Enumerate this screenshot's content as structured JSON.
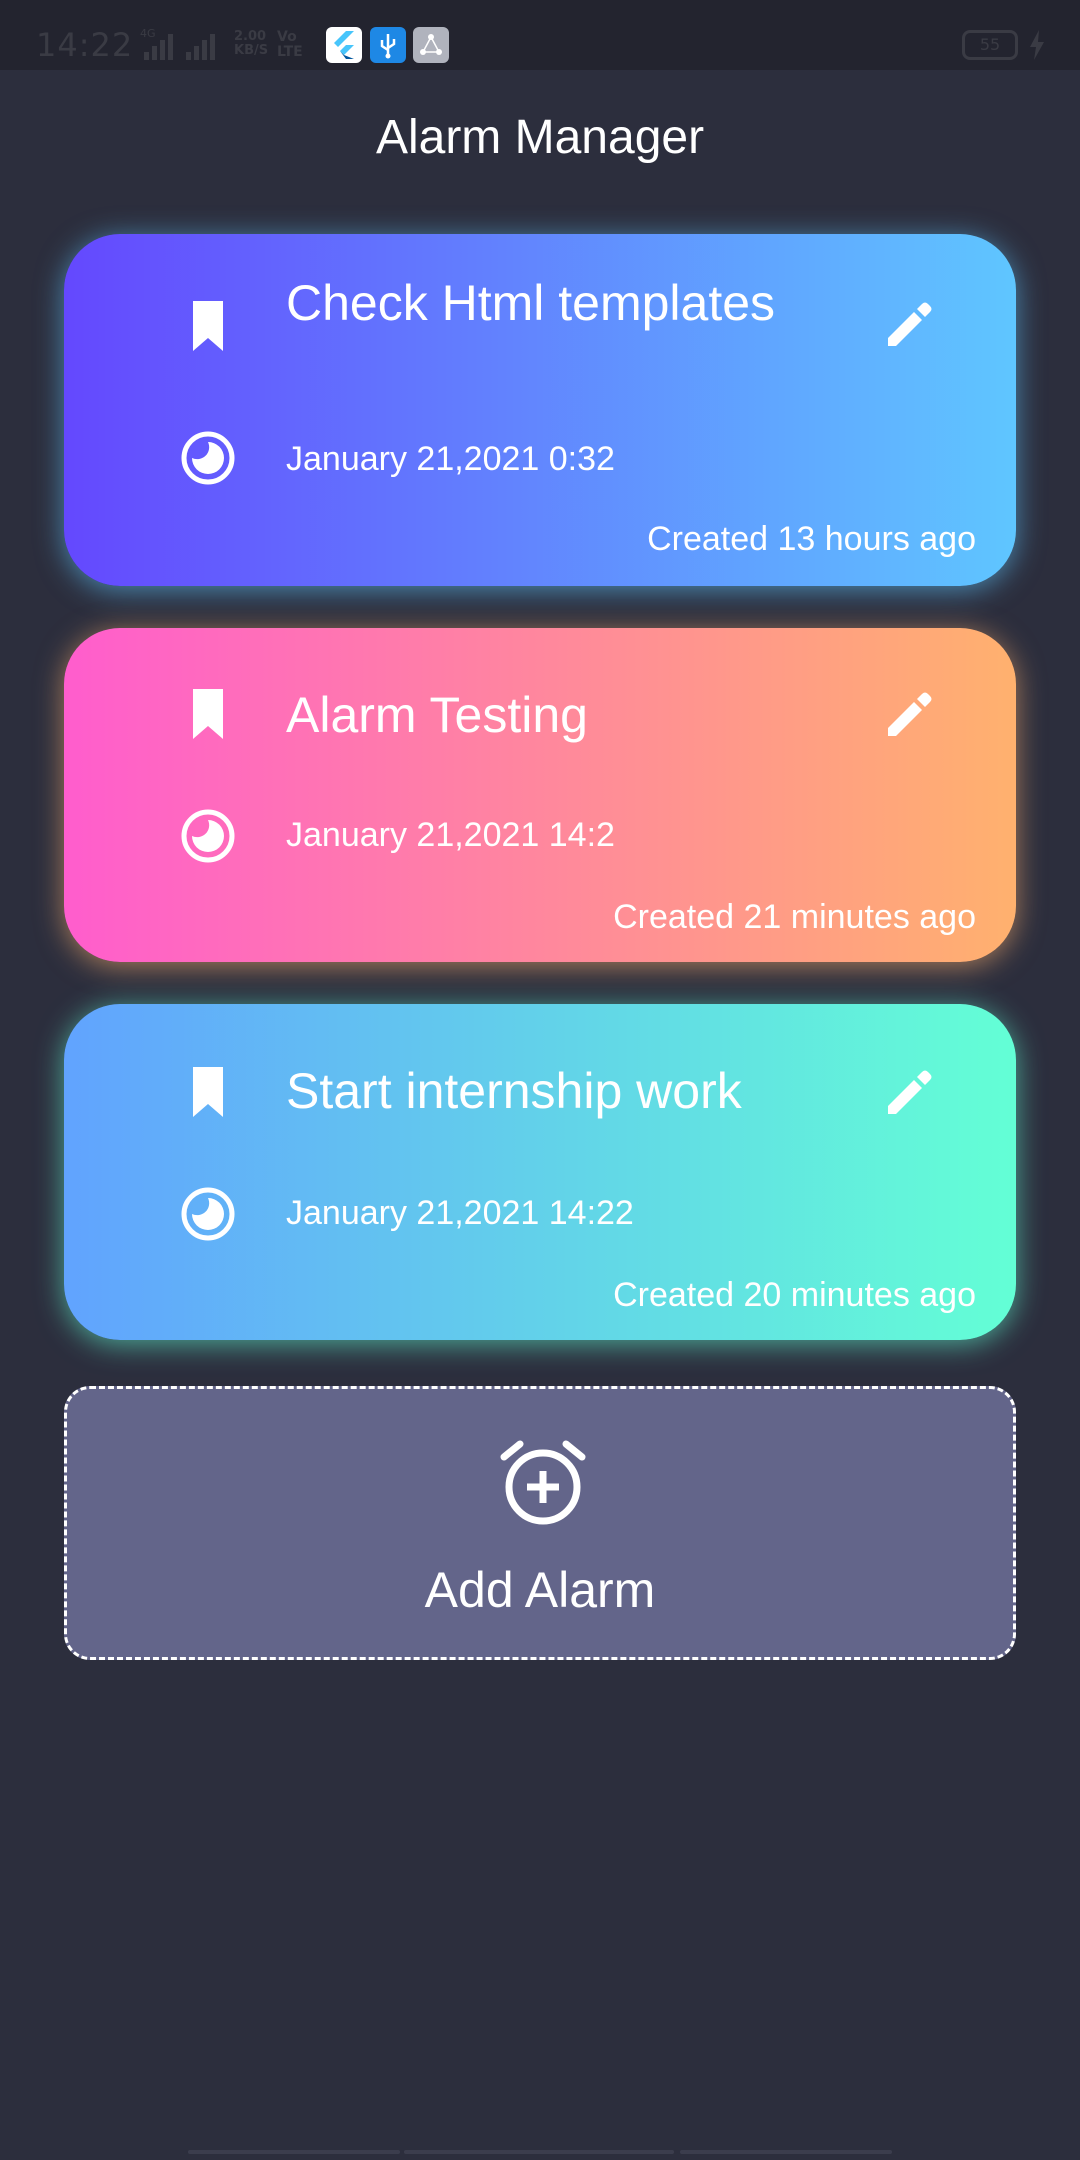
{
  "status_bar": {
    "time": "14:22",
    "network": "4G",
    "speed_value": "2.00",
    "speed_unit": "KB/S",
    "volte_line1": "Vo",
    "volte_line2": "LTE",
    "battery": "55"
  },
  "header": {
    "title": "Alarm Manager"
  },
  "alarms": [
    {
      "title": "Check Html templates",
      "datetime": "January 21,2021 0:32",
      "created": "Created 13 hours ago",
      "gradient": [
        "#6448fe",
        "#5fc6ff"
      ],
      "glow": "#5fc6ff"
    },
    {
      "title": "Alarm Testing",
      "datetime": "January 21,2021 14:2",
      "created": "Created 21 minutes ago",
      "gradient": [
        "#ff5dcd",
        "#ffb16e"
      ],
      "glow": "#ffb16e"
    },
    {
      "title": "Start internship work",
      "datetime": "January 21,2021 14:22",
      "created": "Created 20 minutes ago",
      "gradient": [
        "#61a3fe",
        "#63ffd5"
      ],
      "glow": "#63ffd5"
    }
  ],
  "add_alarm": {
    "label": "Add Alarm"
  },
  "icons": {
    "bookmark": "bookmark-icon",
    "edit": "edit-icon",
    "clock": "clock-icon",
    "add_alarm": "add-alarm-icon"
  }
}
